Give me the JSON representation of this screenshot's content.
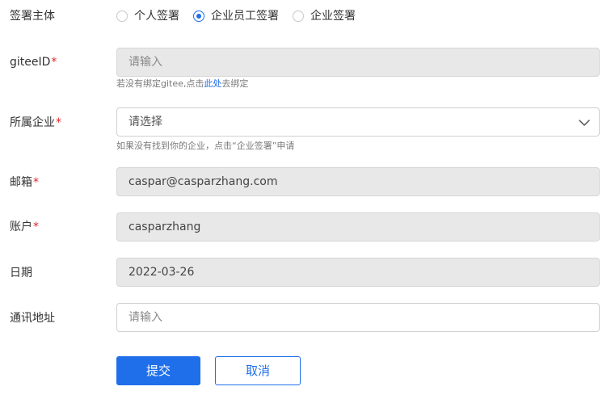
{
  "form": {
    "sign_type": {
      "label": "签署主体",
      "options": [
        {
          "label": "个人签署",
          "checked": false
        },
        {
          "label": "企业员工签署",
          "checked": true
        },
        {
          "label": "企业签署",
          "checked": false
        }
      ]
    },
    "gitee_id": {
      "label": "giteeID",
      "required_mark": "*",
      "placeholder": "请输入",
      "value": "",
      "hint_before": "若没有绑定gitee,点击",
      "hint_link": "此处",
      "hint_after": "去绑定"
    },
    "company": {
      "label": "所属企业",
      "required_mark": "*",
      "placeholder": "请选择",
      "hint": "如果没有找到你的企业，点击“企业签署”申请"
    },
    "email": {
      "label": "邮箱",
      "required_mark": "*",
      "value": "caspar@casparzhang.com"
    },
    "account": {
      "label": "账户",
      "required_mark": "*",
      "value": "casparzhang"
    },
    "date": {
      "label": "日期",
      "value": "2022-03-26"
    },
    "address": {
      "label": "通讯地址",
      "placeholder": "请输入",
      "value": ""
    },
    "submit_label": "提交",
    "cancel_label": "取消"
  },
  "colors": {
    "accent": "#1f6feb",
    "required": "#e0242c",
    "disabled_bg": "#e8e8e8"
  }
}
